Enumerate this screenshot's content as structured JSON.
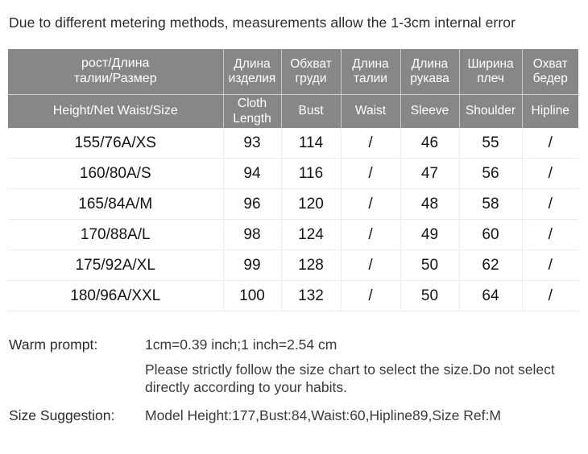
{
  "top_note": "Due to different metering methods, measurements allow the 1-3cm internal error",
  "table": {
    "header_ru": [
      "рост/Длина талии/Размер",
      "Длина изделия",
      "Обхват груди",
      "Длина талии",
      "Длина рукава",
      "Ширина плеч",
      "Охват бедер"
    ],
    "header_ru_lines": [
      [
        "рост/Длина",
        "талии/Размер"
      ],
      [
        "Длина",
        "изделия"
      ],
      [
        "Обхват",
        "груди"
      ],
      [
        "Длина",
        "талии"
      ],
      [
        "Длина",
        "рукава"
      ],
      [
        "Ширина",
        "плеч"
      ],
      [
        "Охват",
        "бедер"
      ]
    ],
    "header_en": [
      "Height/Net  Waist/Size",
      "Cloth Length",
      "Bust",
      "Waist",
      "Sleeve",
      "Shoulder",
      "Hipline"
    ],
    "header_en_lines": [
      [
        "Height/Net  Waist/Size"
      ],
      [
        "Cloth",
        "Length"
      ],
      [
        "Bust"
      ],
      [
        "Waist"
      ],
      [
        "Sleeve"
      ],
      [
        "Shoulder"
      ],
      [
        "Hipline"
      ]
    ],
    "rows": [
      {
        "size": "155/76A/XS",
        "cloth_length": "93",
        "bust": "114",
        "waist": "/",
        "sleeve": "46",
        "shoulder": "55",
        "hipline": "/"
      },
      {
        "size": "160/80A/S",
        "cloth_length": "94",
        "bust": "116",
        "waist": "/",
        "sleeve": "47",
        "shoulder": "56",
        "hipline": "/"
      },
      {
        "size": "165/84A/M",
        "cloth_length": "96",
        "bust": "120",
        "waist": "/",
        "sleeve": "48",
        "shoulder": "58",
        "hipline": "/"
      },
      {
        "size": "170/88A/L",
        "cloth_length": "98",
        "bust": "124",
        "waist": "/",
        "sleeve": "49",
        "shoulder": "60",
        "hipline": "/"
      },
      {
        "size": "175/92A/XL",
        "cloth_length": "99",
        "bust": "128",
        "waist": "/",
        "sleeve": "50",
        "shoulder": "62",
        "hipline": "/"
      },
      {
        "size": "180/96A/XXL",
        "cloth_length": "100",
        "bust": "132",
        "waist": "/",
        "sleeve": "50",
        "shoulder": "64",
        "hipline": "/"
      }
    ]
  },
  "footer": {
    "warm_prompt_label": "Warm prompt:",
    "warm_prompt_value": "1cm=0.39 inch;1 inch=2.54 cm",
    "detail_text": "Please strictly follow the size chart  to select the size.Do not select directly according to your habits.",
    "size_suggestion_label": "Size Suggestion:",
    "size_suggestion_value": "Model Height:177,Bust:84,Waist:60,Hipline89,Size Ref:M"
  },
  "colors": {
    "header_bg": "#878787",
    "header_text": "#ffffff",
    "body_text": "#141414",
    "note_text": "#2b2b2b",
    "row_divider": "#ededed",
    "header_divider": "#c9c9c9",
    "page_bg": "#ffffff"
  }
}
